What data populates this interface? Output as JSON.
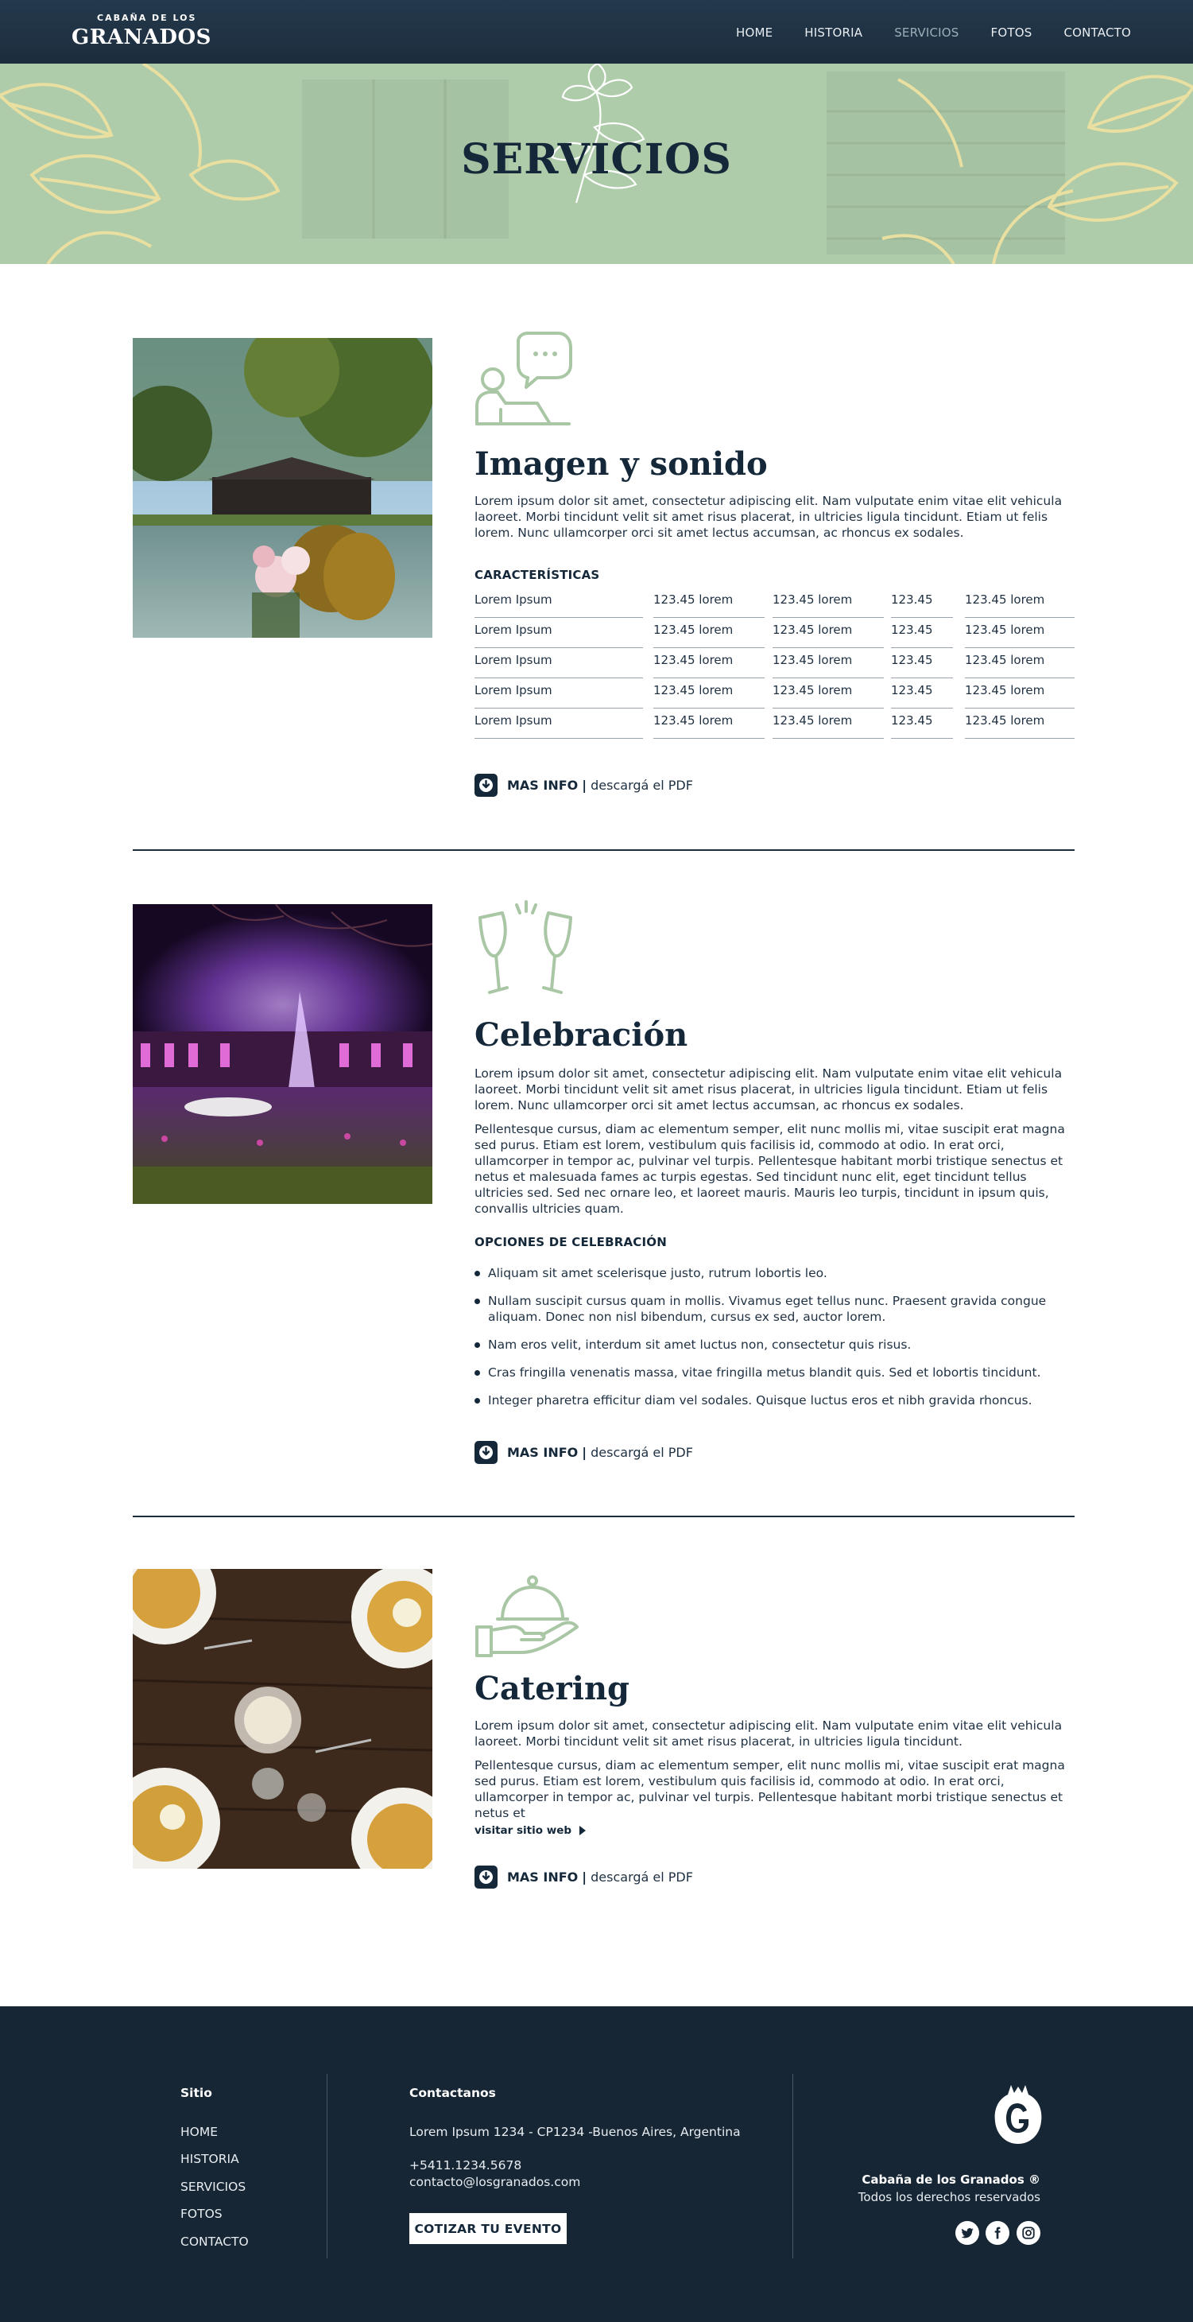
{
  "header": {
    "logo_top": "CABAÑA DE LOS",
    "logo_main": "GRANADOS",
    "nav": [
      {
        "label": "HOME"
      },
      {
        "label": "HISTORIA"
      },
      {
        "label": "SERVICIOS"
      },
      {
        "label": "FOTOS"
      },
      {
        "label": "CONTACTO"
      }
    ],
    "active_nav": "SERVICIOS"
  },
  "hero": {
    "title": "SERVICIOS"
  },
  "sections": [
    {
      "icon": "presenter-chat-icon",
      "title": "Imagen y sonido",
      "paragraphs": [
        "Lorem ipsum dolor sit amet, consectetur adipiscing elit. Nam vulputate enim vitae elit vehicula laoreet. Morbi tincidunt velit sit amet risus placerat, in ultricies ligula tincidunt. Etiam ut felis lorem. Nunc ullamcorper orci sit amet lectus accumsan, ac rhoncus ex sodales."
      ],
      "subheading": "CARACTERÍSTICAS",
      "table": [
        [
          "Lorem Ipsum",
          "123.45 lorem",
          "123.45 lorem",
          "123.45",
          "123.45 lorem"
        ],
        [
          "Lorem Ipsum",
          "123.45 lorem",
          "123.45 lorem",
          "123.45",
          "123.45 lorem"
        ],
        [
          "Lorem Ipsum",
          "123.45 lorem",
          "123.45 lorem",
          "123.45",
          "123.45 lorem"
        ],
        [
          "Lorem Ipsum",
          "123.45 lorem",
          "123.45 lorem",
          "123.45",
          "123.45 lorem"
        ],
        [
          "Lorem Ipsum",
          "123.45 lorem",
          "123.45 lorem",
          "123.45",
          "123.45 lorem"
        ]
      ],
      "more_info": {
        "bold": "MAS INFO",
        "sep": "|",
        "text": "descargá el PDF"
      }
    },
    {
      "icon": "champagne-toast-icon",
      "title": "Celebración",
      "paragraphs": [
        "Lorem ipsum dolor sit amet, consectetur adipiscing elit. Nam vulputate enim vitae elit vehicula laoreet. Morbi tincidunt velit sit amet risus placerat, in ultricies ligula tincidunt. Etiam ut felis lorem. Nunc ullamcorper orci sit amet lectus accumsan, ac rhoncus ex sodales.",
        "Pellentesque cursus, diam ac elementum semper, elit nunc mollis mi, vitae suscipit erat magna sed purus. Etiam est lorem, vestibulum quis facilisis id, commodo at odio. In erat orci, ullamcorper in tempor ac, pulvinar vel turpis. Pellentesque habitant morbi tristique senectus et netus et malesuada fames ac turpis egestas. Sed tincidunt nunc elit, eget tincidunt tellus ultricies sed. Sed nec ornare leo, et laoreet mauris. Mauris leo turpis, tincidunt in ipsum quis, convallis ultricies quam."
      ],
      "subheading": "OPCIONES DE CELEBRACIÓN",
      "bullets": [
        "Aliquam sit amet scelerisque justo, rutrum lobortis leo.",
        "Nullam suscipit cursus quam in mollis. Vivamus eget tellus nunc. Praesent gravida congue aliquam. Donec non nisl bibendum, cursus ex sed, auctor lorem.",
        "Nam eros velit, interdum sit amet luctus non, consectetur quis risus.",
        "Cras fringilla venenatis massa, vitae fringilla metus blandit quis. Sed et lobortis tincidunt.",
        "Integer pharetra efficitur diam vel sodales. Quisque luctus eros et nibh gravida rhoncus."
      ],
      "more_info": {
        "bold": "MAS INFO",
        "sep": "|",
        "text": "descargá el PDF"
      }
    },
    {
      "icon": "serving-cloche-icon",
      "title": "Catering",
      "paragraphs": [
        "Lorem ipsum dolor sit amet, consectetur adipiscing elit. Nam vulputate enim vitae elit vehicula laoreet. Morbi tincidunt velit sit amet risus placerat, in ultricies ligula tincidunt.",
        "Pellentesque cursus, diam ac elementum semper, elit nunc mollis mi, vitae suscipit erat magna sed purus. Etiam est lorem, vestibulum quis facilisis id, commodo at odio. In erat orci, ullamcorper in tempor ac, pulvinar vel turpis. Pellentesque habitant morbi tristique senectus et netus et"
      ],
      "visit_link": "visitar sitio web",
      "more_info": {
        "bold": "MAS INFO",
        "sep": "|",
        "text": "descargá el PDF"
      }
    }
  ],
  "footer": {
    "site_title": "Sitio",
    "site_links": [
      "HOME",
      "HISTORIA",
      "SERVICIOS",
      "FOTOS",
      "CONTACTO"
    ],
    "contact_title": "Contactanos",
    "address": "Lorem Ipsum 1234 - CP1234 -Buenos Aires, Argentina",
    "phone": "+5411.1234.5678",
    "email": "contacto@losgranados.com",
    "cta": "COTIZAR TU EVENTO",
    "brand_name": "Cabaña de los Granados ®",
    "rights": "Todos los derechos reservados",
    "social": [
      "twitter-icon",
      "facebook-icon",
      "instagram-icon"
    ]
  },
  "colors": {
    "navy": "#14283a",
    "footer_bg": "#172635",
    "hero_green": "#aecbaa",
    "icon_green": "#a9c6a5",
    "nav_active": "#9aafb8"
  }
}
